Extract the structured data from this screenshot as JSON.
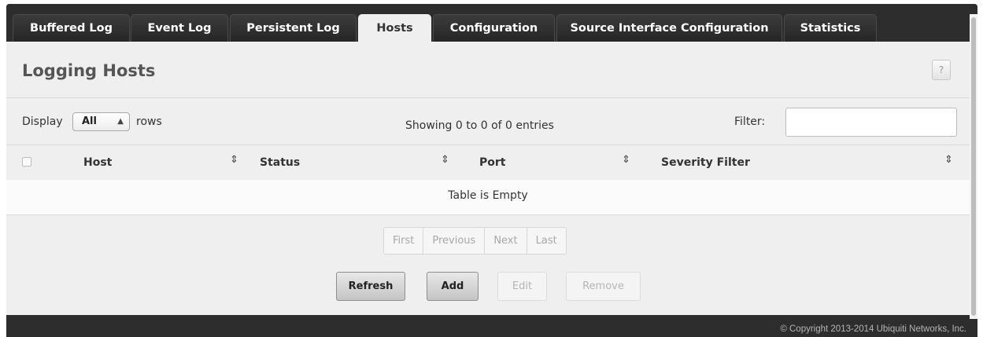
{
  "tabs": [
    {
      "label": "Buffered Log",
      "active": false
    },
    {
      "label": "Event Log",
      "active": false
    },
    {
      "label": "Persistent Log",
      "active": false
    },
    {
      "label": "Hosts",
      "active": true
    },
    {
      "label": "Configuration",
      "active": false
    },
    {
      "label": "Source Interface Configuration",
      "active": false
    },
    {
      "label": "Statistics",
      "active": false
    }
  ],
  "page": {
    "title": "Logging Hosts",
    "help_label": "?"
  },
  "controls": {
    "display_label": "Display",
    "rows_select_value": "All",
    "rows_label": "rows",
    "showing_text": "Showing 0 to 0 of 0 entries",
    "filter_label": "Filter:",
    "filter_value": ""
  },
  "table": {
    "columns": [
      "Host",
      "Status",
      "Port",
      "Severity Filter"
    ],
    "empty_text": "Table is Empty",
    "rows": []
  },
  "pagination": [
    "First",
    "Previous",
    "Next",
    "Last"
  ],
  "actions": {
    "refresh": "Refresh",
    "add": "Add",
    "edit": "Edit",
    "remove": "Remove"
  },
  "footer": {
    "copyright": "© Copyright 2013-2014 Ubiquiti Networks, Inc."
  },
  "icons": {
    "sort": "sort-updown-icon",
    "select_arrows": "select-updown-icon"
  },
  "colors": {
    "chrome": "#2d2d2d",
    "panel": "#efefef",
    "active_tab": "#efefef"
  }
}
